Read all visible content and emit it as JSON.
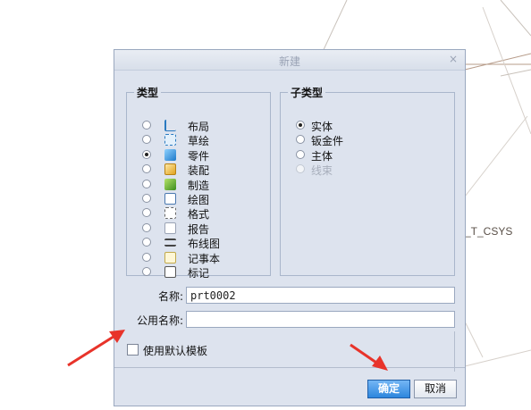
{
  "background": {
    "label": "_T_CSYS"
  },
  "dialog": {
    "title": "新建",
    "close_glyph": "×",
    "type_group": {
      "legend": "类型",
      "items": [
        {
          "label": "布局",
          "icon": "layout-icon",
          "selected": false
        },
        {
          "label": "草绘",
          "icon": "sketch-icon",
          "selected": false
        },
        {
          "label": "零件",
          "icon": "part-icon",
          "selected": true
        },
        {
          "label": "装配",
          "icon": "assembly-icon",
          "selected": false
        },
        {
          "label": "制造",
          "icon": "manufacturing-icon",
          "selected": false
        },
        {
          "label": "绘图",
          "icon": "drawing-icon",
          "selected": false
        },
        {
          "label": "格式",
          "icon": "format-icon",
          "selected": false
        },
        {
          "label": "报告",
          "icon": "report-icon",
          "selected": false
        },
        {
          "label": "布线图",
          "icon": "cable-diagram-icon",
          "selected": false
        },
        {
          "label": "记事本",
          "icon": "notebook-icon",
          "selected": false
        },
        {
          "label": "标记",
          "icon": "markup-icon",
          "selected": false
        }
      ]
    },
    "subtype_group": {
      "legend": "子类型",
      "items": [
        {
          "label": "实体",
          "selected": true,
          "enabled": true
        },
        {
          "label": "钣金件",
          "selected": false,
          "enabled": true
        },
        {
          "label": "主体",
          "selected": false,
          "enabled": true
        },
        {
          "label": "线束",
          "selected": false,
          "enabled": false
        }
      ]
    },
    "name_label": "名称:",
    "name_value": "prt0002",
    "common_name_label": "公用名称:",
    "common_name_value": "",
    "use_default_template_label": "使用默认模板",
    "use_default_template_checked": false,
    "ok_label": "确定",
    "cancel_label": "取消"
  },
  "colors": {
    "annotation_arrow": "#e8332a",
    "primary_button": "#2d86dd"
  }
}
